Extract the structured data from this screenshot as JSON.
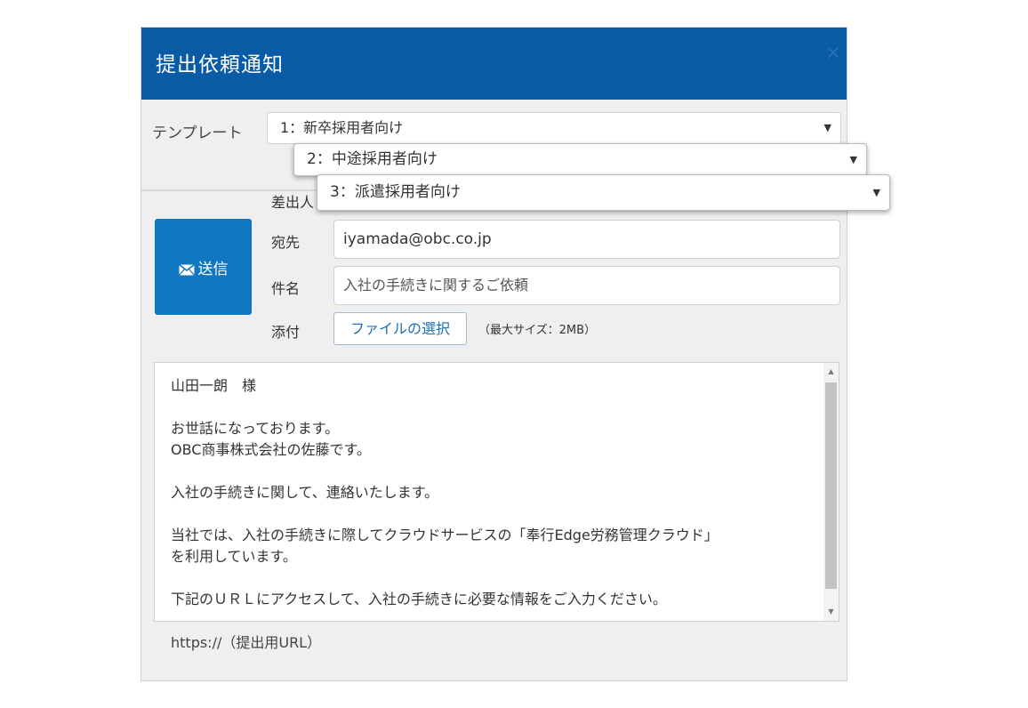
{
  "dialog": {
    "title": "提出依頼通知",
    "close_label": "×"
  },
  "template": {
    "label": "テンプレート",
    "options": [
      "1：新卒採用者向け",
      "2：中途採用者向け",
      "3：派遣採用者向け"
    ],
    "arrow": "▼"
  },
  "send_button": {
    "label": "送信",
    "icon": "mail-icon"
  },
  "fields": {
    "sender_label": "差出人",
    "to_label": "宛先",
    "to_value": "iyamada@obc.co.jp",
    "subject_label": "件名",
    "subject_value": "入社の手続きに関するご依頼",
    "attach_label": "添付",
    "file_button": "ファイルの選択",
    "file_note": "（最大サイズ：2MB）"
  },
  "body": {
    "text": "山田一朗　様\n\nお世話になっております。\nOBC商事株式会社の佐藤です。\n\n入社の手続きに関して、連絡いたします。\n\n当社では、入社の手続きに際してクラウドサービスの「奉行Edge労務管理クラウド」\nを利用しています。\n\n下記のＵＲＬにアクセスして、入社の手続きに必要な情報をご入力ください。"
  },
  "url_line": "https://（提出用URL）"
}
